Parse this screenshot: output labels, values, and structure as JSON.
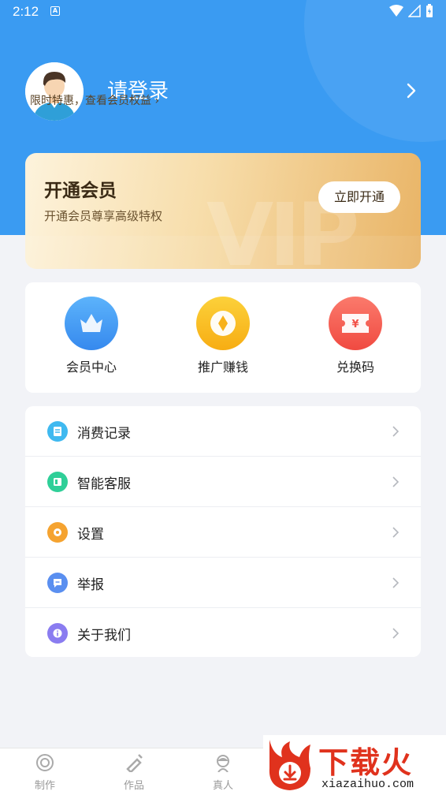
{
  "status_bar": {
    "time": "2:12",
    "notification_glyph": "A"
  },
  "profile": {
    "login_text": "请登录"
  },
  "vip": {
    "title": "开通会员",
    "subtitle": "开通会员尊享高级特权",
    "open_button": "立即开通",
    "link_text": "限时特惠，查看会员权益 ›",
    "watermark": "VIP"
  },
  "quick_actions": [
    {
      "label": "会员中心",
      "icon": "crown-icon",
      "color": "#3f9bf5"
    },
    {
      "label": "推广赚钱",
      "icon": "coin-icon",
      "color": "#fbbf1f"
    },
    {
      "label": "兑换码",
      "icon": "ticket-icon",
      "color": "#f4584f"
    }
  ],
  "menu": [
    {
      "label": "消费记录",
      "icon": "receipt-icon",
      "color": "#3fb9f0"
    },
    {
      "label": "智能客服",
      "icon": "service-icon",
      "color": "#2fcf98"
    },
    {
      "label": "设置",
      "icon": "gear-icon",
      "color": "#f5a330"
    },
    {
      "label": "举报",
      "icon": "report-icon",
      "color": "#5a8ff0"
    },
    {
      "label": "关于我们",
      "icon": "info-icon",
      "color": "#8a7cf0"
    }
  ],
  "tabs": [
    {
      "label": "制作",
      "icon": "make-icon"
    },
    {
      "label": "作品",
      "icon": "works-icon"
    },
    {
      "label": "真人",
      "icon": "person-icon"
    }
  ],
  "watermark_logo": {
    "text": "下载火",
    "url": "xiazaihuo.com"
  },
  "colors": {
    "header_blue": "#3a9bf2",
    "page_bg": "#f2f3f7",
    "vip_gold": "#e9b466"
  }
}
